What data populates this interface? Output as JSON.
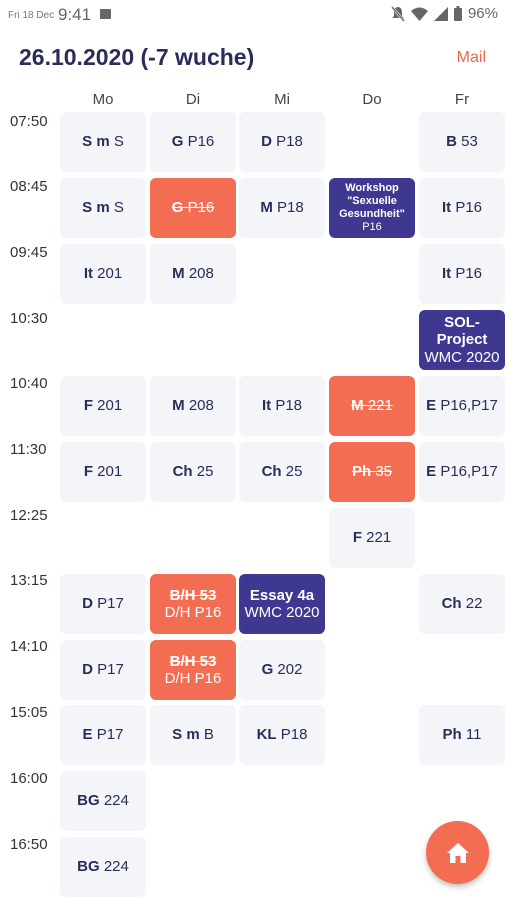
{
  "status_bar": {
    "date": "Fri 18 Dec",
    "time": "9:41",
    "battery": "96%"
  },
  "header": {
    "title": "26.10.2020 (-7 wuche)",
    "mail_label": "Mail"
  },
  "days": [
    "Mo",
    "Di",
    "Mi",
    "Do",
    "Fr"
  ],
  "times": [
    "07:50",
    "08:45",
    "09:45",
    "10:30",
    "10:40",
    "11:30",
    "12:25",
    "13:15",
    "14:10",
    "15:05",
    "16:00",
    "16:50"
  ],
  "cells": [
    {
      "row": 0,
      "col": 0,
      "subject": "S m",
      "room": "S",
      "status": "normal"
    },
    {
      "row": 0,
      "col": 1,
      "subject": "G",
      "room": "P16",
      "status": "normal"
    },
    {
      "row": 0,
      "col": 2,
      "subject": "D",
      "room": "P18",
      "status": "normal"
    },
    {
      "row": 0,
      "col": 4,
      "subject": "B",
      "room": "53",
      "status": "normal"
    },
    {
      "row": 1,
      "col": 0,
      "subject": "S m",
      "room": "S",
      "status": "normal"
    },
    {
      "row": 1,
      "col": 1,
      "subject": "G",
      "room": "P16",
      "status": "cancelled"
    },
    {
      "row": 1,
      "col": 2,
      "subject": "M",
      "room": "P18",
      "status": "normal"
    },
    {
      "row": 1,
      "col": 3,
      "lines": [
        "Workshop",
        "\"Sexuelle",
        "Gesundheit\"",
        "P16"
      ],
      "status": "workshop"
    },
    {
      "row": 1,
      "col": 4,
      "subject": "It",
      "room": "P16",
      "status": "normal"
    },
    {
      "row": 2,
      "col": 0,
      "subject": "It",
      "room": "201",
      "status": "normal"
    },
    {
      "row": 2,
      "col": 1,
      "subject": "M",
      "room": "208",
      "status": "normal"
    },
    {
      "row": 2,
      "col": 4,
      "subject": "It",
      "room": "P16",
      "status": "normal"
    },
    {
      "row": 3,
      "col": 4,
      "lines": [
        "SOL-Project",
        "WMC 2020"
      ],
      "status": "event"
    },
    {
      "row": 4,
      "col": 0,
      "subject": "F",
      "room": "201",
      "status": "normal"
    },
    {
      "row": 4,
      "col": 1,
      "subject": "M",
      "room": "208",
      "status": "normal"
    },
    {
      "row": 4,
      "col": 2,
      "subject": "It",
      "room": "P18",
      "status": "normal"
    },
    {
      "row": 4,
      "col": 3,
      "subject": "M",
      "room": "221",
      "status": "cancelled"
    },
    {
      "row": 4,
      "col": 4,
      "subject": "E",
      "room": "P16,P17",
      "status": "normal"
    },
    {
      "row": 5,
      "col": 0,
      "subject": "F",
      "room": "201",
      "status": "normal"
    },
    {
      "row": 5,
      "col": 1,
      "subject": "Ch",
      "room": "25",
      "status": "normal"
    },
    {
      "row": 5,
      "col": 2,
      "subject": "Ch",
      "room": "25",
      "status": "normal"
    },
    {
      "row": 5,
      "col": 3,
      "subject": "Ph",
      "room": "35",
      "status": "cancelled"
    },
    {
      "row": 5,
      "col": 4,
      "subject": "E",
      "room": "P16,P17",
      "status": "normal"
    },
    {
      "row": 6,
      "col": 3,
      "subject": "F",
      "room": "221",
      "status": "normal"
    },
    {
      "row": 7,
      "col": 0,
      "subject": "D",
      "room": "P17",
      "status": "normal"
    },
    {
      "row": 7,
      "col": 1,
      "lines": [
        "B/H 53",
        "D/H P16"
      ],
      "status": "substitution"
    },
    {
      "row": 7,
      "col": 2,
      "lines": [
        "Essay 4a",
        "WMC 2020"
      ],
      "status": "event"
    },
    {
      "row": 7,
      "col": 4,
      "subject": "Ch",
      "room": "22",
      "status": "normal"
    },
    {
      "row": 8,
      "col": 0,
      "subject": "D",
      "room": "P17",
      "status": "normal"
    },
    {
      "row": 8,
      "col": 1,
      "lines": [
        "B/H 53",
        "D/H P16"
      ],
      "status": "substitution"
    },
    {
      "row": 8,
      "col": 2,
      "subject": "G",
      "room": "202",
      "status": "normal"
    },
    {
      "row": 9,
      "col": 0,
      "subject": "E",
      "room": "P17",
      "status": "normal"
    },
    {
      "row": 9,
      "col": 1,
      "subject": "S m",
      "room": "B",
      "status": "normal"
    },
    {
      "row": 9,
      "col": 2,
      "subject": "KL",
      "room": "P18",
      "status": "normal"
    },
    {
      "row": 9,
      "col": 4,
      "subject": "Ph",
      "room": "11",
      "status": "normal"
    },
    {
      "row": 10,
      "col": 0,
      "subject": "BG",
      "room": "224",
      "status": "normal"
    },
    {
      "row": 11,
      "col": 0,
      "subject": "BG",
      "room": "224",
      "status": "normal"
    }
  ],
  "colors": {
    "accent": "#f26d52",
    "event": "#3f3890",
    "cell_bg": "#f4f5f9",
    "title": "#2c2c5a"
  },
  "fab": {
    "icon": "home-icon"
  }
}
